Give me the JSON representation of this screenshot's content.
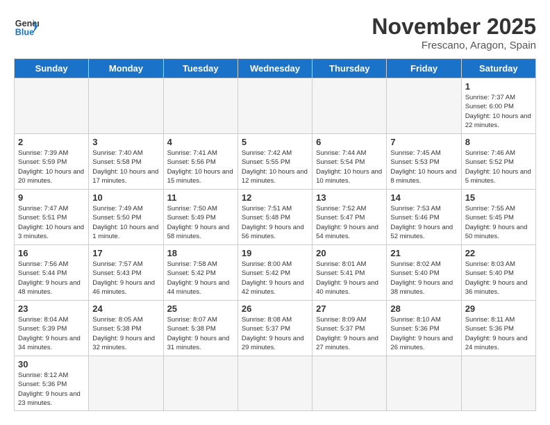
{
  "header": {
    "logo_general": "General",
    "logo_blue": "Blue",
    "month_year": "November 2025",
    "location": "Frescano, Aragon, Spain"
  },
  "days_of_week": [
    "Sunday",
    "Monday",
    "Tuesday",
    "Wednesday",
    "Thursday",
    "Friday",
    "Saturday"
  ],
  "weeks": [
    [
      {
        "day": "",
        "info": ""
      },
      {
        "day": "",
        "info": ""
      },
      {
        "day": "",
        "info": ""
      },
      {
        "day": "",
        "info": ""
      },
      {
        "day": "",
        "info": ""
      },
      {
        "day": "",
        "info": ""
      },
      {
        "day": "1",
        "info": "Sunrise: 7:37 AM\nSunset: 6:00 PM\nDaylight: 10 hours and 22 minutes."
      }
    ],
    [
      {
        "day": "2",
        "info": "Sunrise: 7:39 AM\nSunset: 5:59 PM\nDaylight: 10 hours and 20 minutes."
      },
      {
        "day": "3",
        "info": "Sunrise: 7:40 AM\nSunset: 5:58 PM\nDaylight: 10 hours and 17 minutes."
      },
      {
        "day": "4",
        "info": "Sunrise: 7:41 AM\nSunset: 5:56 PM\nDaylight: 10 hours and 15 minutes."
      },
      {
        "day": "5",
        "info": "Sunrise: 7:42 AM\nSunset: 5:55 PM\nDaylight: 10 hours and 12 minutes."
      },
      {
        "day": "6",
        "info": "Sunrise: 7:44 AM\nSunset: 5:54 PM\nDaylight: 10 hours and 10 minutes."
      },
      {
        "day": "7",
        "info": "Sunrise: 7:45 AM\nSunset: 5:53 PM\nDaylight: 10 hours and 8 minutes."
      },
      {
        "day": "8",
        "info": "Sunrise: 7:46 AM\nSunset: 5:52 PM\nDaylight: 10 hours and 5 minutes."
      }
    ],
    [
      {
        "day": "9",
        "info": "Sunrise: 7:47 AM\nSunset: 5:51 PM\nDaylight: 10 hours and 3 minutes."
      },
      {
        "day": "10",
        "info": "Sunrise: 7:49 AM\nSunset: 5:50 PM\nDaylight: 10 hours and 1 minute."
      },
      {
        "day": "11",
        "info": "Sunrise: 7:50 AM\nSunset: 5:49 PM\nDaylight: 9 hours and 58 minutes."
      },
      {
        "day": "12",
        "info": "Sunrise: 7:51 AM\nSunset: 5:48 PM\nDaylight: 9 hours and 56 minutes."
      },
      {
        "day": "13",
        "info": "Sunrise: 7:52 AM\nSunset: 5:47 PM\nDaylight: 9 hours and 54 minutes."
      },
      {
        "day": "14",
        "info": "Sunrise: 7:53 AM\nSunset: 5:46 PM\nDaylight: 9 hours and 52 minutes."
      },
      {
        "day": "15",
        "info": "Sunrise: 7:55 AM\nSunset: 5:45 PM\nDaylight: 9 hours and 50 minutes."
      }
    ],
    [
      {
        "day": "16",
        "info": "Sunrise: 7:56 AM\nSunset: 5:44 PM\nDaylight: 9 hours and 48 minutes."
      },
      {
        "day": "17",
        "info": "Sunrise: 7:57 AM\nSunset: 5:43 PM\nDaylight: 9 hours and 46 minutes."
      },
      {
        "day": "18",
        "info": "Sunrise: 7:58 AM\nSunset: 5:42 PM\nDaylight: 9 hours and 44 minutes."
      },
      {
        "day": "19",
        "info": "Sunrise: 8:00 AM\nSunset: 5:42 PM\nDaylight: 9 hours and 42 minutes."
      },
      {
        "day": "20",
        "info": "Sunrise: 8:01 AM\nSunset: 5:41 PM\nDaylight: 9 hours and 40 minutes."
      },
      {
        "day": "21",
        "info": "Sunrise: 8:02 AM\nSunset: 5:40 PM\nDaylight: 9 hours and 38 minutes."
      },
      {
        "day": "22",
        "info": "Sunrise: 8:03 AM\nSunset: 5:40 PM\nDaylight: 9 hours and 36 minutes."
      }
    ],
    [
      {
        "day": "23",
        "info": "Sunrise: 8:04 AM\nSunset: 5:39 PM\nDaylight: 9 hours and 34 minutes."
      },
      {
        "day": "24",
        "info": "Sunrise: 8:05 AM\nSunset: 5:38 PM\nDaylight: 9 hours and 32 minutes."
      },
      {
        "day": "25",
        "info": "Sunrise: 8:07 AM\nSunset: 5:38 PM\nDaylight: 9 hours and 31 minutes."
      },
      {
        "day": "26",
        "info": "Sunrise: 8:08 AM\nSunset: 5:37 PM\nDaylight: 9 hours and 29 minutes."
      },
      {
        "day": "27",
        "info": "Sunrise: 8:09 AM\nSunset: 5:37 PM\nDaylight: 9 hours and 27 minutes."
      },
      {
        "day": "28",
        "info": "Sunrise: 8:10 AM\nSunset: 5:36 PM\nDaylight: 9 hours and 26 minutes."
      },
      {
        "day": "29",
        "info": "Sunrise: 8:11 AM\nSunset: 5:36 PM\nDaylight: 9 hours and 24 minutes."
      }
    ],
    [
      {
        "day": "30",
        "info": "Sunrise: 8:12 AM\nSunset: 5:36 PM\nDaylight: 9 hours and 23 minutes."
      },
      {
        "day": "",
        "info": ""
      },
      {
        "day": "",
        "info": ""
      },
      {
        "day": "",
        "info": ""
      },
      {
        "day": "",
        "info": ""
      },
      {
        "day": "",
        "info": ""
      },
      {
        "day": "",
        "info": ""
      }
    ]
  ]
}
